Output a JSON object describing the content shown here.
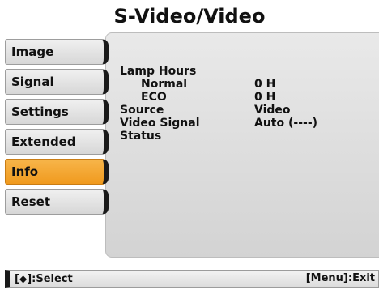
{
  "title": "S-Video/Video",
  "menu": [
    {
      "label": "Image"
    },
    {
      "label": "Signal"
    },
    {
      "label": "Settings"
    },
    {
      "label": "Extended"
    },
    {
      "label": "Info",
      "selected": true
    },
    {
      "label": "Reset"
    }
  ],
  "info": {
    "lamp_hours": {
      "label": "Lamp Hours"
    },
    "normal": {
      "label": "Normal",
      "value": "0 H"
    },
    "eco": {
      "label": "ECO",
      "value": "0 H"
    },
    "source": {
      "label": "Source",
      "value": "Video"
    },
    "video_signal": {
      "label": "Video Signal",
      "value": "Auto (----)"
    },
    "status": {
      "label": "Status"
    }
  },
  "footer": {
    "left_bracket": "[",
    "arrows": "◆",
    "left_rest": "]:Select",
    "right": "[Menu]:Exit"
  },
  "colors": {
    "accent": "#f09a1e",
    "panel": "#dcdcdc"
  }
}
